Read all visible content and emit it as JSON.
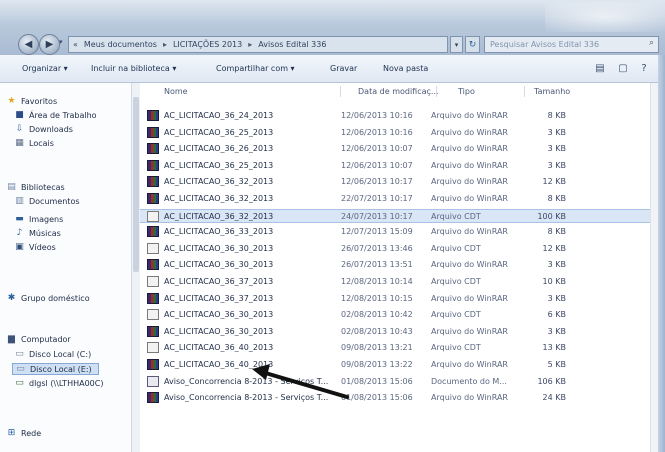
{
  "address": {
    "crumbs": [
      "«",
      "Meus documentos",
      "LICITAÇÕES 2013",
      "Avisos Edital 336"
    ],
    "search_placeholder": "Pesquisar Avisos Edital 336"
  },
  "toolbar": {
    "organize": "Organizar ▾",
    "include_library": "Incluir na biblioteca ▾",
    "share_with": "Compartilhar com ▾",
    "burn": "Gravar",
    "new_folder": "Nova pasta"
  },
  "nav": {
    "favorites": "Favoritos",
    "desktop": "Área de Trabalho",
    "downloads": "Downloads",
    "recent": "Locais",
    "libraries": "Bibliotecas",
    "documents": "Documentos",
    "images": "Imagens",
    "music": "Músicas",
    "videos": "Vídeos",
    "homegroup": "Grupo doméstico",
    "computer": "Computador",
    "disk_c": "Disco Local (C:)",
    "disk_e": "Disco Local (E:)",
    "network_drive": "dlgsl (\\\\LTHHA00C)",
    "network": "Rede"
  },
  "columns": {
    "name": "Nome",
    "date": "Data de modificaç...",
    "type": "Tipo",
    "size": "Tamanho"
  },
  "files": [
    {
      "name": "AC_LICITACAO_36_24_2013",
      "date": "12/06/2013 10:16",
      "type": "Arquivo do WinRAR",
      "size": "8 KB",
      "icon": "winrar"
    },
    {
      "name": "AC_LICITACAO_36_25_2013",
      "date": "12/06/2013 10:16",
      "type": "Arquivo do WinRAR",
      "size": "3 KB",
      "icon": "winrar"
    },
    {
      "name": "AC_LICITACAO_36_26_2013",
      "date": "12/06/2013 10:07",
      "type": "Arquivo do WinRAR",
      "size": "3 KB",
      "icon": "winrar"
    },
    {
      "name": "AC_LICITACAO_36_25_2013",
      "date": "12/06/2013 10:07",
      "type": "Arquivo do WinRAR",
      "size": "3 KB",
      "icon": "winrar"
    },
    {
      "name": "AC_LICITACAO_36_32_2013",
      "date": "12/06/2013 10:17",
      "type": "Arquivo do WinRAR",
      "size": "12 KB",
      "icon": "winrar"
    },
    {
      "name": "AC_LICITACAO_36_32_2013",
      "date": "22/07/2013 10:17",
      "type": "Arquivo do WinRAR",
      "size": "8 KB",
      "icon": "winrar"
    },
    {
      "name": "AC_LICITACAO_36_32_2013",
      "date": "24/07/2013 10:17",
      "type": "Arquivo CDT",
      "size": "100 KB",
      "icon": "cdt",
      "selected": true
    },
    {
      "name": "AC_LICITACAO_36_33_2013",
      "date": "12/07/2013 15:09",
      "type": "Arquivo do WinRAR",
      "size": "8 KB",
      "icon": "winrar"
    },
    {
      "name": "AC_LICITACAO_36_30_2013",
      "date": "26/07/2013 13:46",
      "type": "Arquivo CDT",
      "size": "12 KB",
      "icon": "cdt"
    },
    {
      "name": "AC_LICITACAO_36_30_2013",
      "date": "26/07/2013 13:51",
      "type": "Arquivo do WinRAR",
      "size": "3 KB",
      "icon": "winrar"
    },
    {
      "name": "AC_LICITACAO_36_37_2013",
      "date": "12/08/2013 10:14",
      "type": "Arquivo CDT",
      "size": "10 KB",
      "icon": "cdt"
    },
    {
      "name": "AC_LICITACAO_36_37_2013",
      "date": "12/08/2013 10:15",
      "type": "Arquivo do WinRAR",
      "size": "3 KB",
      "icon": "winrar"
    },
    {
      "name": "AC_LICITACAO_36_30_2013",
      "date": "02/08/2013 10:42",
      "type": "Arquivo CDT",
      "size": "6 KB",
      "icon": "cdt"
    },
    {
      "name": "AC_LICITACAO_36_30_2013",
      "date": "02/08/2013 10:43",
      "type": "Arquivo do WinRAR",
      "size": "3 KB",
      "icon": "winrar"
    },
    {
      "name": "AC_LICITACAO_36_40_2013",
      "date": "09/08/2013 13:21",
      "type": "Arquivo CDT",
      "size": "13 KB",
      "icon": "cdt"
    },
    {
      "name": "AC_LICITACAO_36_40_2013",
      "date": "09/08/2013 13:22",
      "type": "Arquivo do WinRAR",
      "size": "5 KB",
      "icon": "winrar"
    },
    {
      "name": "Aviso_Concorrencia 8-2013 - Serviços T...",
      "date": "01/08/2013 15:06",
      "type": "Documento do M...",
      "size": "106 KB",
      "icon": "pdf"
    },
    {
      "name": "Aviso_Concorrencia 8-2013 - Serviços T...",
      "date": "01/08/2013 15:06",
      "type": "Arquivo do WinRAR",
      "size": "24 KB",
      "icon": "winrar"
    }
  ]
}
